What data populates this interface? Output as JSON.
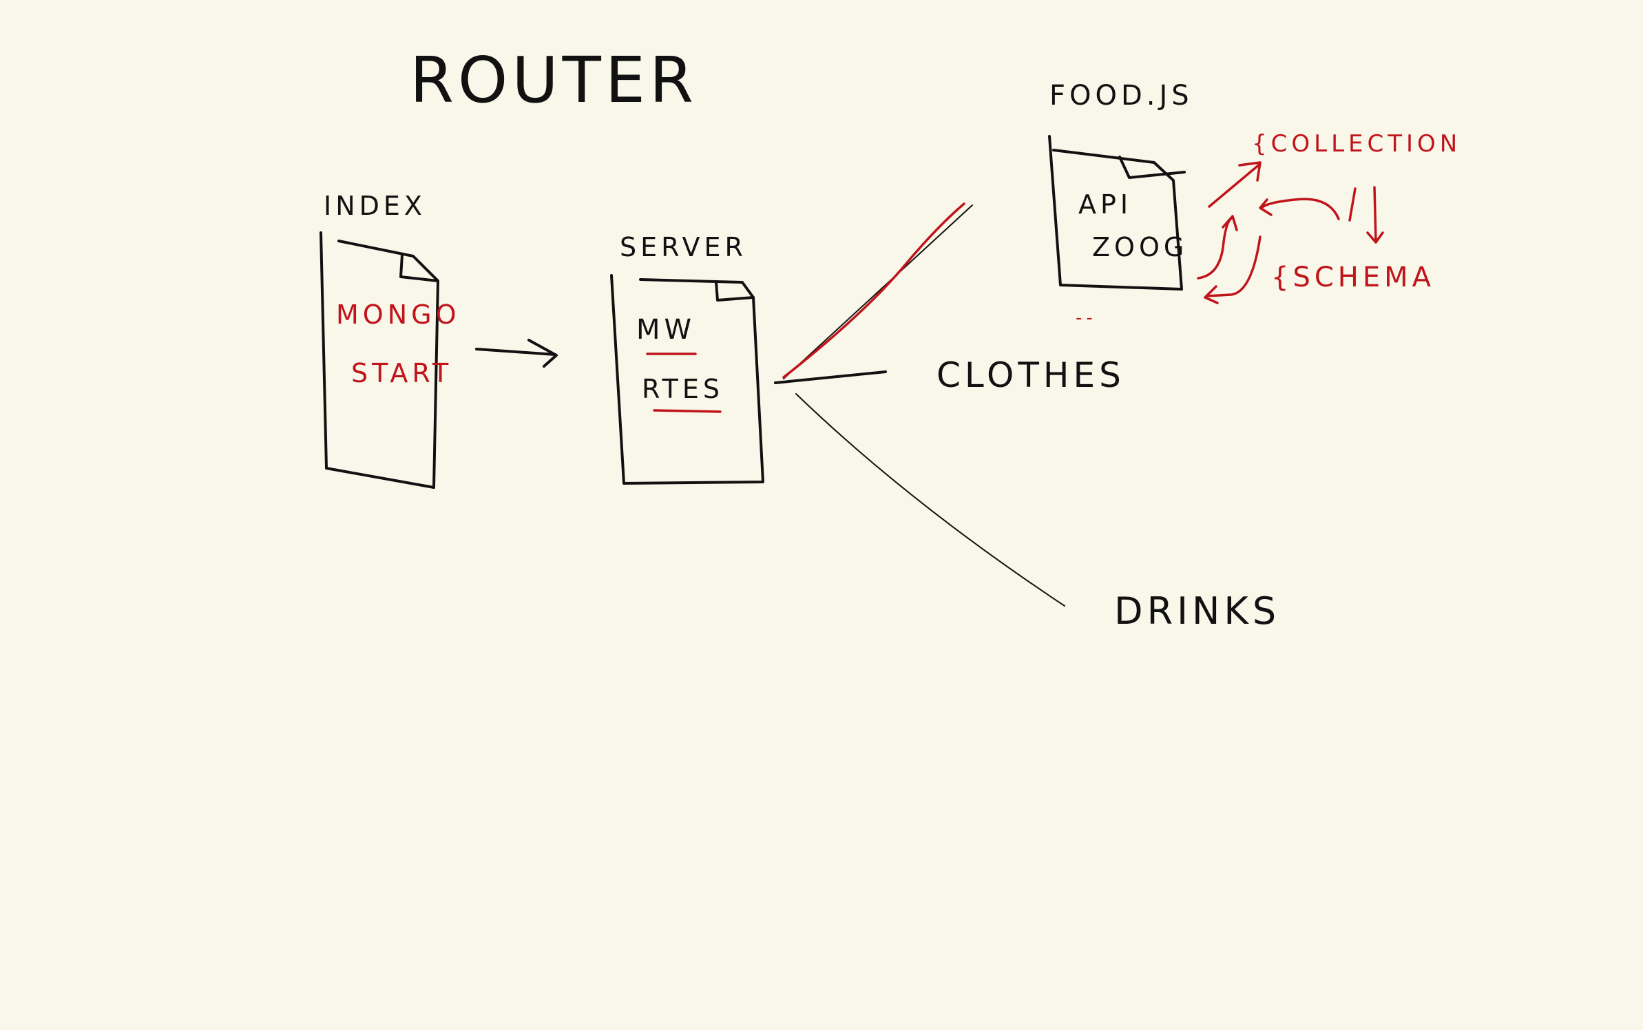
{
  "title": "ROUTER",
  "files": {
    "index": {
      "label": "INDEX",
      "lines": [
        "MONGO",
        "START"
      ]
    },
    "server": {
      "label": "SERVER",
      "lines": [
        "MW",
        "RTES"
      ]
    },
    "food": {
      "label": "FOOD.JS",
      "lines": [
        "API",
        "ZOOG"
      ]
    }
  },
  "routes": {
    "clothes": "CLOTHES",
    "drinks": "DRINKS"
  },
  "annotations": {
    "collection": "{COLLECTION",
    "schema": "{SCHEMA",
    "food_note": "--"
  },
  "colors": {
    "background": "#f8f7ea",
    "ink": "#111111",
    "red": "#c0141a",
    "blue": "#1a7de0"
  }
}
